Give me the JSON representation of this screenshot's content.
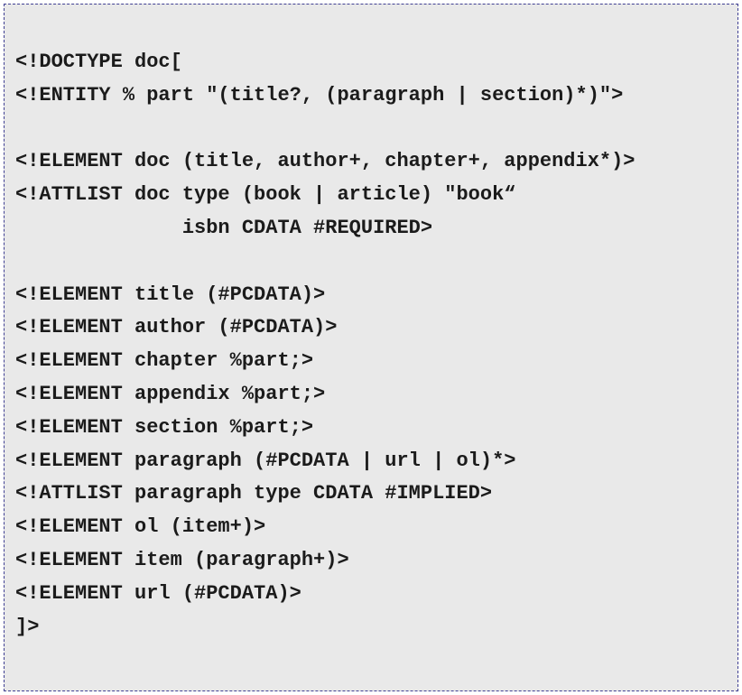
{
  "code_block": {
    "lines": [
      "<!DOCTYPE doc[",
      "<!ENTITY % part \"(title?, (paragraph | section)*)\">",
      "",
      "<!ELEMENT doc (title, author+, chapter+, appendix*)>",
      "<!ATTLIST doc type (book | article) \"book“",
      "              isbn CDATA #REQUIRED>",
      "",
      "<!ELEMENT title (#PCDATA)>",
      "<!ELEMENT author (#PCDATA)>",
      "<!ELEMENT chapter %part;>",
      "<!ELEMENT appendix %part;>",
      "<!ELEMENT section %part;>",
      "<!ELEMENT paragraph (#PCDATA | url | ol)*>",
      "<!ATTLIST paragraph type CDATA #IMPLIED>",
      "<!ELEMENT ol (item+)>",
      "<!ELEMENT item (paragraph+)>",
      "<!ELEMENT url (#PCDATA)>",
      "]>"
    ]
  },
  "colors": {
    "background": "#e9e9e9",
    "border": "#3f3f93",
    "text": "#1b1b1b"
  }
}
